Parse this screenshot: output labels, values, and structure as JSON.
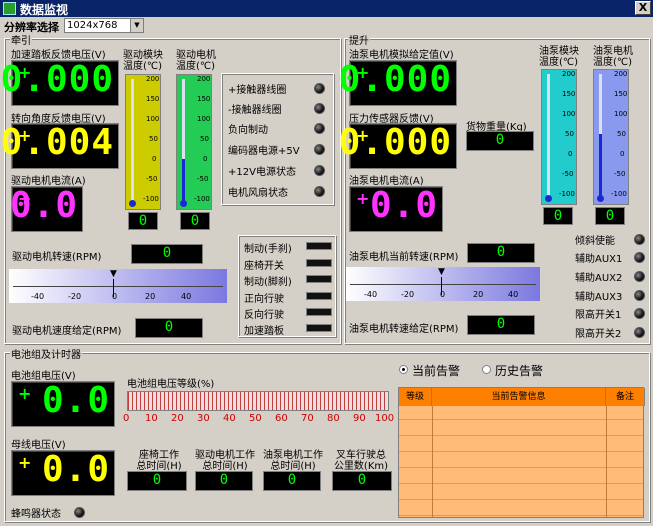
{
  "window": {
    "title": "数据监视",
    "close": "X"
  },
  "toolbar": {
    "resolution_label": "分辨率选择",
    "resolution_value": "1024x768"
  },
  "traction": {
    "group_title": "牵引",
    "accel_label": "加速踏板反馈电压(V)",
    "accel_value": "0.000",
    "accel_sign": "+",
    "steer_label": "转向角度反馈电压(V)",
    "steer_value": "0.004",
    "steer_sign": "+",
    "current_label": "驱动电机电流(A)",
    "current_value": "0.0",
    "current_sign": "+",
    "drive_module_temp_label": "驱动模块 温度(℃)",
    "drive_module_temp_value": "0",
    "drive_motor_temp_label": "驱动电机 温度(℃)",
    "drive_motor_temp_value": "0",
    "therm_ticks": [
      "200",
      "150",
      "100",
      "50",
      "0",
      "-50",
      "-100"
    ],
    "indicators": [
      "+接触器线圈",
      "-接触器线圈",
      "负向制动",
      "编码器电源+5V",
      "+12V电源状态",
      "电机风扇状态"
    ],
    "speed_label": "驱动电机转速(RPM)",
    "speed_value": "0",
    "slider_ticks": [
      "-40",
      "-20",
      "0",
      "20",
      "40"
    ],
    "speed_set_label": "驱动电机速度给定(RPM)",
    "speed_set_value": "0",
    "switches": [
      "制动(手刹)",
      "座椅开关",
      "制动(脚刹)",
      "正向行驶",
      "反向行驶",
      "加速踏板"
    ]
  },
  "lift": {
    "group_title": "提升",
    "pump_given_label": "油泵电机模拟给定值(V)",
    "pump_given_value": "0.000",
    "pump_given_sign": "+",
    "pressure_label": "压力传感器反馈(V)",
    "pressure_value": "0.000",
    "pressure_sign": "+",
    "weight_label": "货物重量(Kg)",
    "weight_value": "0",
    "pump_current_label": "油泵电机电流(A)",
    "pump_current_value": "0.0",
    "pump_current_sign": "+",
    "pump_module_temp_label": "油泵模块 温度(℃)",
    "pump_module_temp_value": "0",
    "pump_motor_temp_label": "油泵电机 温度(℃)",
    "pump_motor_temp_value": "0",
    "therm_ticks": [
      "200",
      "150",
      "100",
      "50",
      "0",
      "-50",
      "-100"
    ],
    "speed_label": "油泵电机当前转速(RPM)",
    "speed_value": "0",
    "slider_ticks": [
      "-40",
      "-20",
      "0",
      "20",
      "40"
    ],
    "speed_set_label": "油泵电机转速给定(RPM)",
    "speed_set_value": "0",
    "indicators": [
      "倾斜使能",
      "辅助AUX1",
      "辅助AUX2",
      "辅助AUX3",
      "限高开关1",
      "限高开关2"
    ]
  },
  "battery": {
    "group_title": "电池组及计时器",
    "pack_voltage_label": "电池组电压(V)",
    "pack_voltage_value": "0.0",
    "pack_voltage_sign": "+",
    "bus_voltage_label": "母线电压(V)",
    "bus_voltage_value": "0.0",
    "bus_voltage_sign": "+",
    "level_label": "电池组电压等级(%)",
    "level_value": 0,
    "level_ticks": [
      "0",
      "10",
      "20",
      "30",
      "40",
      "50",
      "60",
      "70",
      "80",
      "90",
      "100"
    ],
    "buzzer_label": "蜂鸣器状态",
    "timers": [
      {
        "label1": "座椅工作",
        "label2": "总时间(H)",
        "value": "0"
      },
      {
        "label1": "驱动电机工作",
        "label2": "总时间(H)",
        "value": "0"
      },
      {
        "label1": "油泵电机工作",
        "label2": "总时间(H)",
        "value": "0"
      },
      {
        "label1": "叉车行驶总",
        "label2": "公里数(Km)",
        "value": "0"
      }
    ]
  },
  "alarms": {
    "current_label": "当前告警",
    "history_label": "历史告警",
    "col_level": "等级",
    "col_info": "当前告警信息",
    "col_note": "备注"
  }
}
